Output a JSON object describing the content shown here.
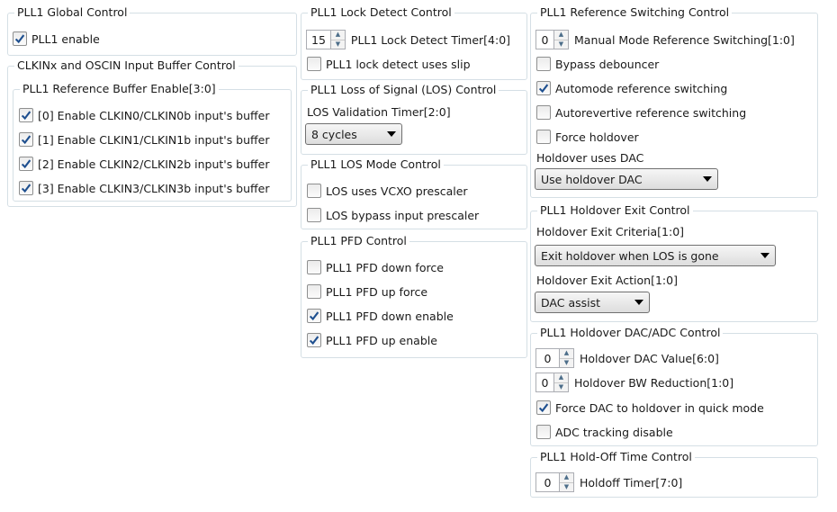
{
  "icons": {
    "check": "check-icon",
    "up": "arrow-up-icon",
    "down": "arrow-down-icon",
    "dropdown": "chevron-down-icon"
  },
  "colors": {
    "check": "#1e4f8f",
    "border": "#d5dfe5"
  },
  "global": {
    "title": "PLL1 Global Control",
    "enable": {
      "label": "PLL1 enable",
      "checked": true
    }
  },
  "input_buffer": {
    "title": "CLKINx and OSCIN Input Buffer Control",
    "sub_title": "PLL1 Reference Buffer Enable[3:0]",
    "items": [
      {
        "label": "[0] Enable CLKIN0/CLKIN0b input's buffer",
        "checked": true
      },
      {
        "label": "[1] Enable CLKIN1/CLKIN1b input's buffer",
        "checked": true
      },
      {
        "label": "[2] Enable CLKIN2/CLKIN2b input's buffer",
        "checked": true
      },
      {
        "label": "[3] Enable CLKIN3/CLKIN3b input's buffer",
        "checked": true
      }
    ]
  },
  "lock_detect": {
    "title": "PLL1 Lock Detect Control",
    "timer": {
      "value": "15",
      "label": "PLL1 Lock Detect Timer[4:0]"
    },
    "slip": {
      "label": "PLL1 lock detect uses slip",
      "checked": false
    }
  },
  "los": {
    "title": "PLL1 Loss of Signal (LOS) Control",
    "validation_label": "LOS Validation Timer[2:0]",
    "validation_value": "8 cycles"
  },
  "los_mode": {
    "title": "PLL1 LOS Mode Control",
    "items": [
      {
        "label": "LOS uses VCXO prescaler",
        "checked": false
      },
      {
        "label": "LOS bypass input prescaler",
        "checked": false
      }
    ]
  },
  "pfd": {
    "title": "PLL1 PFD Control",
    "items": [
      {
        "label": "PLL1 PFD down force",
        "checked": false
      },
      {
        "label": "PLL1 PFD up force",
        "checked": false
      },
      {
        "label": "PLL1 PFD down enable",
        "checked": true
      },
      {
        "label": "PLL1 PFD up enable",
        "checked": true
      }
    ]
  },
  "ref_switch": {
    "title": "PLL1 Reference Switching Control",
    "manual": {
      "value": "0",
      "label": "Manual Mode Reference Switching[1:0]"
    },
    "items": [
      {
        "label": "Bypass debouncer",
        "checked": false
      },
      {
        "label": "Automode reference switching",
        "checked": true
      },
      {
        "label": "Autorevertive reference switching",
        "checked": false
      },
      {
        "label": "Force holdover",
        "checked": false
      }
    ],
    "dac_label": "Holdover uses DAC",
    "dac_value": "Use holdover DAC"
  },
  "holdover_exit": {
    "title": "PLL1 Holdover Exit Control",
    "criteria_label": "Holdover Exit Criteria[1:0]",
    "criteria_value": "Exit holdover when LOS is gone",
    "action_label": "Holdover Exit Action[1:0]",
    "action_value": "DAC assist"
  },
  "dac_adc": {
    "title": "PLL1 Holdover DAC/ADC Control",
    "dac_value": {
      "value": "0",
      "label": "Holdover DAC Value[6:0]"
    },
    "bw": {
      "value": "0",
      "label": "Holdover BW Reduction[1:0]"
    },
    "items": [
      {
        "label": "Force DAC to holdover in quick mode",
        "checked": true
      },
      {
        "label": "ADC tracking disable",
        "checked": false
      }
    ]
  },
  "holdoff": {
    "title": "PLL1 Hold-Off Time Control",
    "timer": {
      "value": "0",
      "label": "Holdoff Timer[7:0]"
    }
  },
  "figure_id": "13041-013"
}
